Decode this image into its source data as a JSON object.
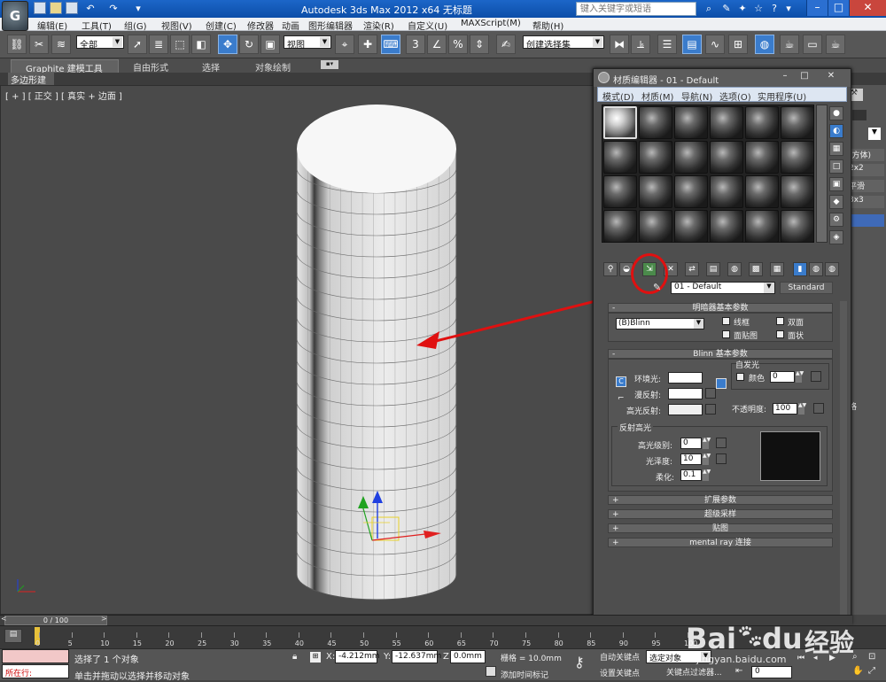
{
  "window": {
    "title": "Autodesk 3ds Max  2012 x64      无标题",
    "search_placeholder": "键入关键字或短语",
    "logo": "G"
  },
  "menu": [
    "编辑(E)",
    "工具(T)",
    "组(G)",
    "视图(V)",
    "创建(C)",
    "修改器",
    "动画",
    "图形编辑器",
    "渲染(R)",
    "自定义(U)",
    "MAXScript(M)",
    "帮助(H)"
  ],
  "toolbar": {
    "selection_filter": "全部",
    "ref_coord": "视图",
    "named_selection": "创建选择集",
    "snap_3": "3",
    "snap_percent": "%"
  },
  "ribbon": {
    "tabs": [
      "Graphite 建模工具",
      "自由形式",
      "选择",
      "对象绘制"
    ],
    "subtab": "多边形建模"
  },
  "viewport": {
    "label": "[ + ] [ 正交 ] [ 真实 + 边面 ]"
  },
  "command_panel": {
    "labels": [
      "(方体)",
      "2x2",
      "平滑",
      "3x3"
    ],
    "right_text": "格"
  },
  "material_editor": {
    "title": "材质编辑器 - 01 - Default",
    "menu": [
      "模式(D)",
      "材质(M)",
      "导航(N)",
      "选项(O)",
      "实用程序(U)"
    ],
    "material_name": "01 - Default",
    "material_type": "Standard",
    "shader_rollout": {
      "title": "明暗器基本参数",
      "shader": "(B)Blinn",
      "options": [
        "线框",
        "双面",
        "面贴图",
        "面状"
      ]
    },
    "blinn_rollout": {
      "title": "Blinn 基本参数",
      "self_illum_label": "自发光",
      "color_label": "颜色",
      "self_illum_value": "0",
      "ambient_label": "环境光:",
      "diffuse_label": "漫反射:",
      "specular_label": "高光反射:",
      "opacity_label": "不透明度:",
      "opacity_value": "100",
      "ambient_lock": "C"
    },
    "specular_highlights": {
      "title": "反射高光",
      "level_label": "高光级别:",
      "level_value": "0",
      "gloss_label": "光泽度:",
      "gloss_value": "10",
      "soften_label": "柔化:",
      "soften_value": "0.1"
    },
    "collapsed_rollouts": [
      "扩展参数",
      "超级采样",
      "贴图",
      "mental ray 连接"
    ]
  },
  "timeline": {
    "slider_label": "0 / 100",
    "ticks": [
      "0",
      "5",
      "10",
      "15",
      "20",
      "25",
      "30",
      "35",
      "40",
      "45",
      "50",
      "55",
      "60",
      "65",
      "70",
      "75",
      "80",
      "85",
      "90",
      "95",
      "100"
    ]
  },
  "status": {
    "script_label": "所在行:",
    "message": "选择了 1 个对象",
    "prompt": "单击并拖动以选择并移动对象",
    "x_label": "X:",
    "x_value": "-4.212mm",
    "y_label": "Y:",
    "y_value": "-12.637mm",
    "z_label": "Z:",
    "z_value": "0.0mm",
    "grid": "栅格 = 10.0mm",
    "add_time_tag": "添加时间标记",
    "auto_key": "自动关键点",
    "set_key": "设置关键点",
    "selection_set": "选定对象",
    "key_filters": "关键点过滤器...",
    "frame": "0"
  },
  "watermark": {
    "brand": "Bai",
    "brand2": "du",
    "text": "经验",
    "url": "jingyan.baidu.com"
  },
  "colors": {
    "annotation_red": "#e01010",
    "title_blue": "#1760c4",
    "viewport_bg": "#4a4a4a"
  }
}
